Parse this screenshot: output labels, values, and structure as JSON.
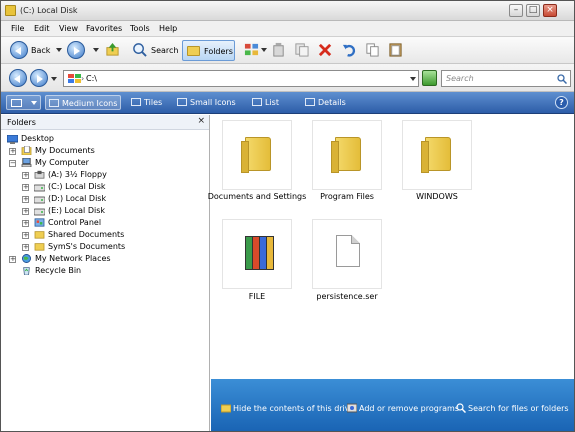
{
  "window": {
    "title": "(C:) Local Disk"
  },
  "menu": [
    "File",
    "Edit",
    "View",
    "Favorites",
    "Tools",
    "Help"
  ],
  "toolbar": {
    "back_label": "Back",
    "search_label": "Search",
    "folders_label": "Folders"
  },
  "address": {
    "value": "C:\\",
    "search_placeholder": "Search"
  },
  "viewbar": {
    "items": [
      "Medium Icons",
      "Tiles",
      "Small Icons",
      "List",
      "Details"
    ],
    "active": "Medium Icons",
    "help": "?"
  },
  "folders_pane": {
    "title": "Folders",
    "close": "×",
    "tree": [
      {
        "label": "Desktop"
      },
      {
        "label": "My Documents"
      },
      {
        "label": "My Computer"
      },
      {
        "label": "(A:) 3½ Floppy"
      },
      {
        "label": "(C:) Local Disk"
      },
      {
        "label": "(D:) Local Disk"
      },
      {
        "label": "(E:) Local Disk"
      },
      {
        "label": "Control Panel"
      },
      {
        "label": "Shared Documents"
      },
      {
        "label": "SymS's Documents"
      },
      {
        "label": "My Network Places"
      },
      {
        "label": "Recycle Bin"
      }
    ]
  },
  "files": [
    {
      "name": "Documents and Settings",
      "type": "folder"
    },
    {
      "name": "Program Files",
      "type": "folder"
    },
    {
      "name": "WINDOWS",
      "type": "folder"
    },
    {
      "name": "FILE",
      "type": "books"
    },
    {
      "name": "persistence.ser",
      "type": "document"
    }
  ],
  "tasks": [
    "Hide the contents of this drive",
    "Add or remove programs",
    "Search for files or folders"
  ]
}
